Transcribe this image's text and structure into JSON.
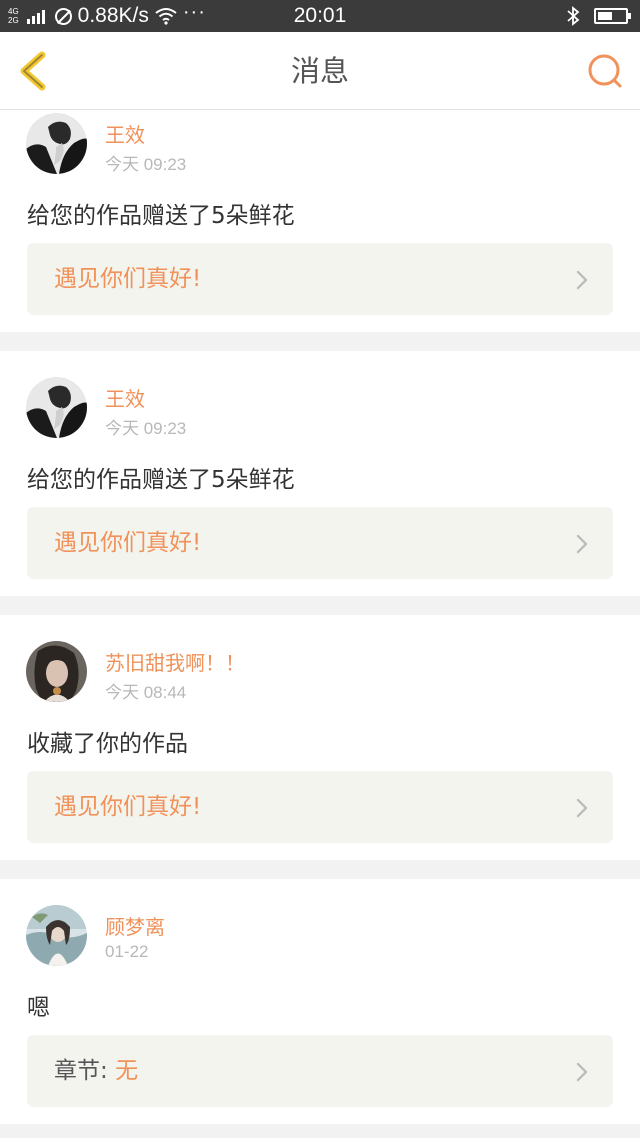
{
  "status_bar": {
    "network_top": "4G",
    "network_bottom": "2G",
    "speed": "0.88K/s",
    "more": "···",
    "time": "20:01",
    "battery_level": 0.55
  },
  "nav": {
    "title": "消息",
    "back_icon": "chevron-left-icon",
    "search_icon": "search-icon",
    "accent_color": "#f0925a",
    "back_color": "#f3c730"
  },
  "messages": [
    {
      "user": "王效",
      "time": "今天 09:23",
      "text": "给您的作品赠送了5朵鲜花",
      "work": "遇见你们真好!"
    },
    {
      "user": "王效",
      "time": "今天 09:23",
      "text": "给您的作品赠送了5朵鲜花",
      "work": "遇见你们真好!"
    },
    {
      "user": "苏旧甜我啊！！",
      "time": "今天 08:44",
      "text": "收藏了你的作品",
      "work": "遇见你们真好!"
    },
    {
      "user": "顾梦离",
      "time": "01-22",
      "text": "嗯",
      "chapter_label": "章节:",
      "chapter_value": "无"
    }
  ]
}
